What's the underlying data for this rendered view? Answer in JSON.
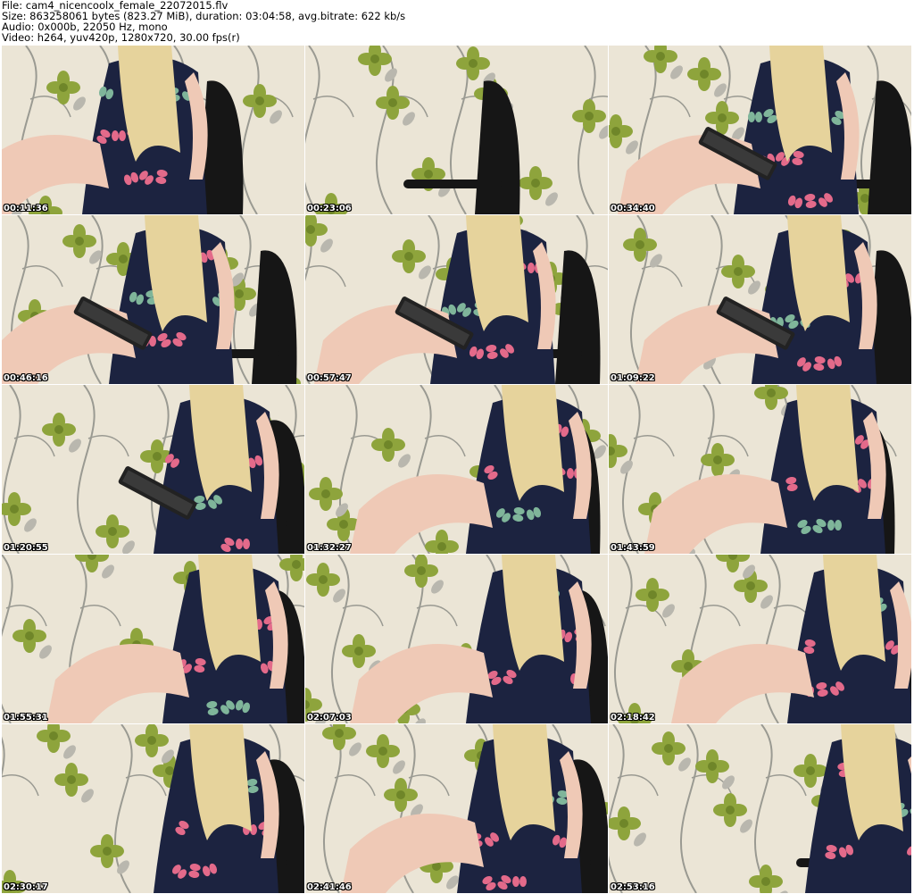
{
  "info": {
    "file": "File: cam4_nicencoolx_female_22072015.flv",
    "size": "Size: 863258061 bytes (823.27 MiB), duration: 03:04:58, avg.bitrate: 622 kb/s",
    "audio": "Audio: 0x000b, 22050 Hz, mono",
    "video": "Video: h264, yuv420p, 1280x720, 30.00 fps(r)"
  },
  "thumbnails": [
    {
      "time": "00:11:36"
    },
    {
      "time": "00:23:06"
    },
    {
      "time": "00:34:40"
    },
    {
      "time": "00:46:16"
    },
    {
      "time": "00:57:47"
    },
    {
      "time": "01:09:22"
    },
    {
      "time": "01:20:55"
    },
    {
      "time": "01:32:27"
    },
    {
      "time": "01:43:59"
    },
    {
      "time": "01:55:31"
    },
    {
      "time": "02:07:03"
    },
    {
      "time": "02:18:42"
    },
    {
      "time": "02:30:17"
    },
    {
      "time": "02:41:46"
    },
    {
      "time": "02:53:16"
    }
  ],
  "colors": {
    "wallpaper": "#ebe5d6",
    "leaf": "#8ea43c",
    "leaf_dark": "#6f8629",
    "stem": "#9a9a92",
    "dress": "#1c2340",
    "butterfly_pink": "#e36a8a",
    "butterfly_green": "#7fb59a",
    "hair": "#e6d39c",
    "skin": "#efc9b6",
    "chair": "#161616",
    "keyboard": "#222222"
  }
}
